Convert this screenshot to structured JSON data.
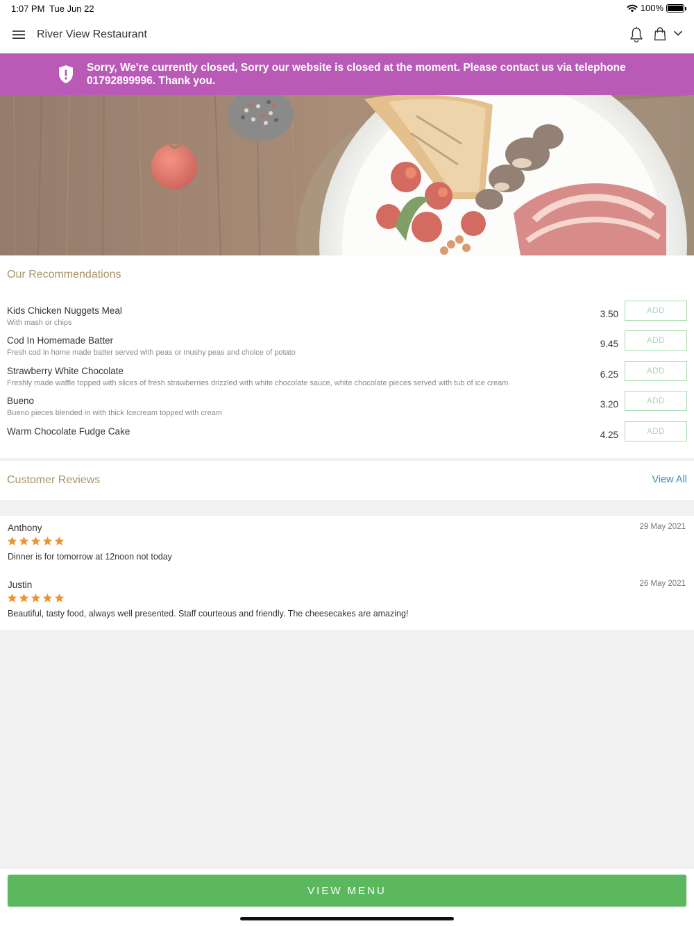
{
  "status_bar": {
    "time": "1:07 PM",
    "date": "Tue Jun 22",
    "battery": "100%"
  },
  "header": {
    "title": "River View Restaurant",
    "menu_icon": "hamburger-icon",
    "bell_icon": "bell-icon",
    "bag_icon": "shopping-bag-icon",
    "dropdown_icon": "chevron-down-icon"
  },
  "banner": {
    "icon": "shield-alert-icon",
    "message": "Sorry, We're currently closed, Sorry our website is closed at the moment. Please contact us via telephone 01792899996. Thank you.",
    "color": "#b95ab7"
  },
  "recommendations": {
    "title": "Our Recommendations",
    "add_label": "ADD",
    "items": [
      {
        "name": "Kids Chicken Nuggets Meal",
        "description": "With mash or chips",
        "price": "3.50"
      },
      {
        "name": "Cod In Homemade Batter",
        "description": "Fresh cod in home made batter served with peas or mushy peas and choice of potato",
        "price": "9.45"
      },
      {
        "name": "Strawberry White Chocolate",
        "description": "Freshly made waffle topped with slices of fresh strawberries drizzled with white chocolate sauce, white chocolate pieces served with tub of ice cream",
        "price": "6.25"
      },
      {
        "name": "Bueno",
        "description": "Bueno pieces blended in with thick Icecream topped with cream",
        "price": "3.20"
      },
      {
        "name": "Warm Chocolate Fudge Cake",
        "description": "",
        "price": "4.25"
      }
    ]
  },
  "reviews": {
    "title": "Customer Reviews",
    "view_all": "View All",
    "star_color": "#f0922b",
    "items": [
      {
        "author": "Anthony",
        "date": "29 May 2021",
        "rating": 5,
        "text": "Dinner is for tomorrow at 12noon not today"
      },
      {
        "author": "Justin",
        "date": "26 May 2021",
        "rating": 5,
        "text": "Beautiful, tasty food, always well presented. Staff courteous and friendly. The cheesecakes are amazing!"
      }
    ]
  },
  "footer": {
    "view_menu": "VIEW MENU",
    "color": "#5cb85f"
  }
}
